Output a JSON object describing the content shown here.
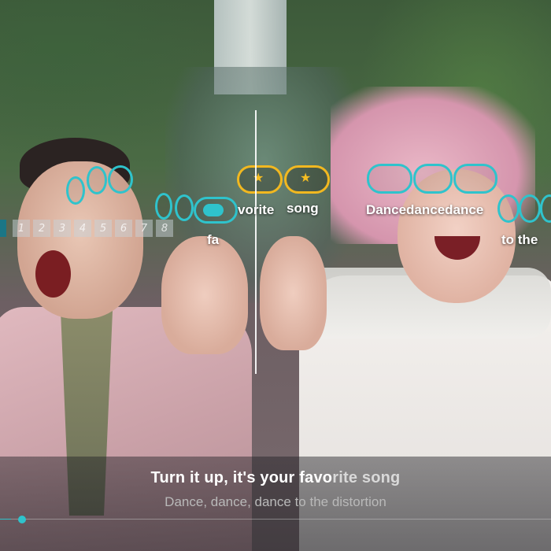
{
  "pitch_ladder": [
    "1",
    "2",
    "3",
    "4",
    "5",
    "6",
    "7",
    "8"
  ],
  "note_words": {
    "fa": "fa",
    "vorite": "vorite",
    "song": "song",
    "dancedancedance": "Dancedancedance",
    "to_the": "to the"
  },
  "lyrics": {
    "current_sung": "Turn it up, it's your favo",
    "current_rest": "rite song",
    "next": "Dance, dance, dance to the distortion"
  },
  "progress": {
    "fraction": 0.02
  },
  "colors": {
    "accent": "#2fc3cc",
    "gold": "#f2b820",
    "star": "#f5bd22"
  },
  "icons": {
    "star": "star-icon"
  }
}
